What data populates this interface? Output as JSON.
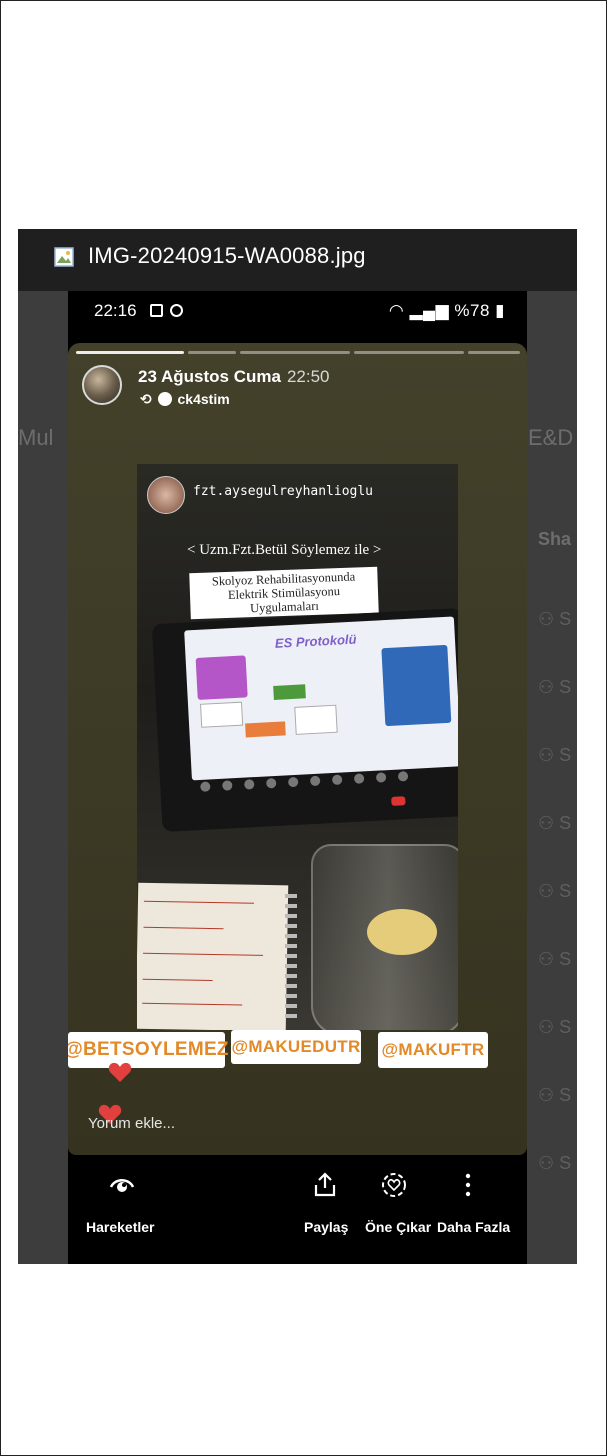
{
  "viewer": {
    "file_name": "IMG-20240915-WA0088.jpg"
  },
  "background": {
    "left_text": "Mul",
    "right_text_1": "E&D",
    "right_text_2": "Sha",
    "row_icon": "people-icon",
    "row_letter": "S"
  },
  "status_bar": {
    "time": "22:16",
    "right": "%78"
  },
  "story": {
    "date": "23 Ağustos Cuma",
    "time": "22:50",
    "repost_user": "ck4stim",
    "photo_username": "fzt.aysegulreyhanlioglu",
    "caption_1": "< Uzm.Fzt.Betül Söylemez ile >",
    "caption_2": "Skolyoz Rehabilitasyonunda Elektrik Stimülasyonu Uygulamaları",
    "slide_title": "ES Protokolü",
    "mentions": [
      "@BETSOYLEMEZ",
      "@MAKUEDUTR",
      "@MAKUFTR"
    ],
    "comment_placeholder": "Yorum ekle..."
  },
  "actions": {
    "activity": "Hareketler",
    "share": "Paylaş",
    "highlight": "Öne Çıkar",
    "more": "Daha Fazla"
  },
  "colors": {
    "heart": "#e2403f",
    "mention_text": "#e28a2a",
    "viewer_bar": "#1f1f1f"
  }
}
